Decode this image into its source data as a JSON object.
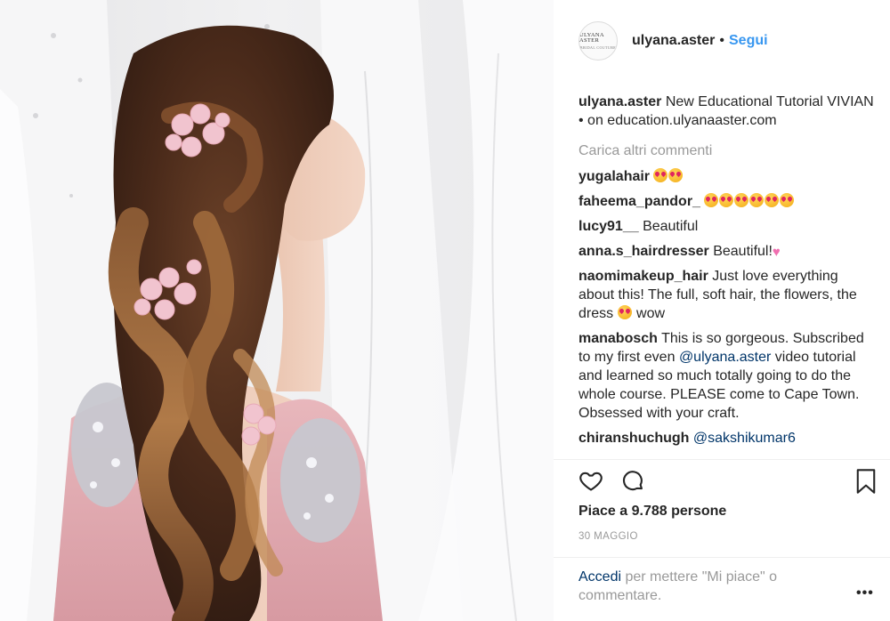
{
  "post": {
    "username": "ulyana.aster",
    "separator": "•",
    "follow_label": "Segui",
    "avatar_line1": "ULYANA ASTER",
    "avatar_line2": "BRIDAL COUTURE"
  },
  "caption": {
    "username": "ulyana.aster",
    "text": "New Educational Tutorial VIVIAN • on education.ulyanaaster.com"
  },
  "load_more_label": "Carica altri commenti",
  "comments": [
    {
      "user": "yugalahair",
      "text": ""
    },
    {
      "user": "faheema_pandor_",
      "text": ""
    },
    {
      "user": "lucy91__",
      "text": "Beautiful"
    },
    {
      "user": "anna.s_hairdresser",
      "text": "Beautiful!"
    },
    {
      "user": "naomimakeup_hair",
      "text_a": "Just love everything about this! The full, soft hair, the flowers, the dress",
      "text_b": "wow"
    },
    {
      "user": "manabosch",
      "text_a": "This is so gorgeous. Subscribed to my first even",
      "mention": "@ulyana.aster",
      "text_b": "video tutorial and learned so much totally going to do the whole course. PLEASE come to Cape Town. Obsessed with your craft."
    },
    {
      "user": "chiranshuchugh",
      "mention": "@sakshikumar6"
    }
  ],
  "likes_text": "Piace a 9.788 persone",
  "date_text": "30 MAGGIO",
  "login": {
    "link": "Accedi",
    "text": "per mettere \"Mi piace\" o commentare."
  },
  "more_label": "•••",
  "icons": {
    "like": "heart-icon",
    "comment": "comment-bubble-icon",
    "save": "bookmark-icon",
    "more": "more-options-icon"
  },
  "colors": {
    "link_blue": "#3897f0",
    "mention_blue": "#003569",
    "muted_gray": "#999999",
    "text": "#262626"
  }
}
